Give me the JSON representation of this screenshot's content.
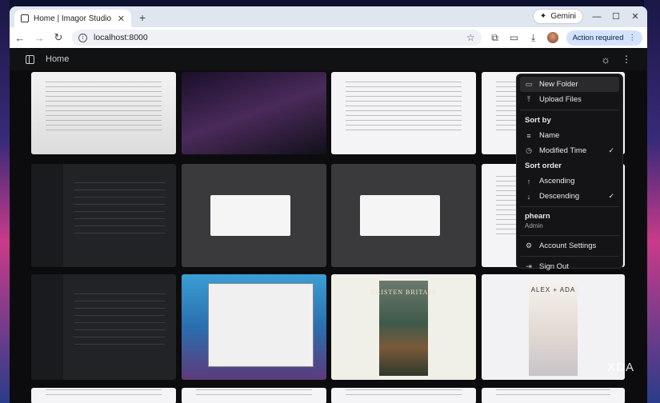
{
  "browser": {
    "tab_title": "Home | Imagor Studio",
    "gemini_label": "Gemini",
    "url": "localhost:8000",
    "action_label": "Action required"
  },
  "app": {
    "header_title": "Home"
  },
  "menu": {
    "new_folder": "New Folder",
    "upload_files": "Upload Files",
    "sort_by_heading": "Sort by",
    "sort_name": "Name",
    "sort_modified": "Modified Time",
    "sort_order_heading": "Sort order",
    "order_ascending": "Ascending",
    "order_descending": "Descending",
    "user_name": "phearn",
    "user_role": "Admin",
    "account_settings": "Account Settings",
    "sign_out": "Sign Out"
  },
  "thumbnails": {
    "book1_title": "KRISTEN BRITAIN",
    "book2_title": "ALEX + ADA"
  },
  "watermark": "XDA"
}
